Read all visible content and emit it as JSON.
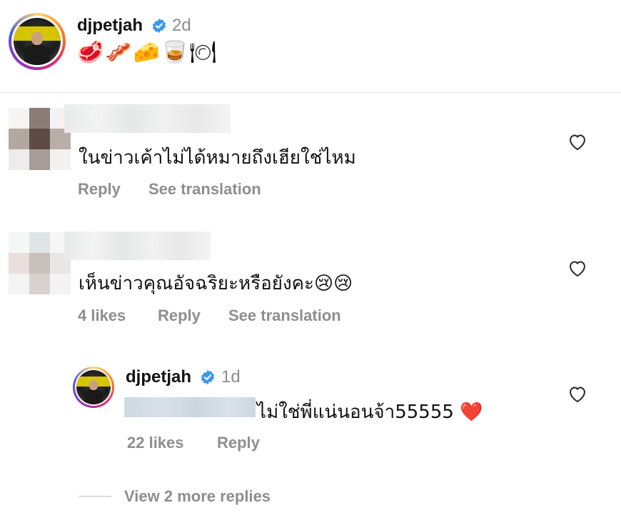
{
  "post": {
    "username": "djpetjah",
    "timestamp": "2d",
    "caption_emoji": "🥩🥓🧀🥃🍽"
  },
  "comments": [
    {
      "text": "ในข่าวเค้าไม่ได้หมายถึงเฮียใช่ไหม",
      "likes": "",
      "reply_label": "Reply",
      "translate_label": "See translation"
    },
    {
      "text": "เห็นข่าวคุณอัจฉริยะหรือยังคะ😢😢",
      "likes": "4 likes",
      "reply_label": "Reply",
      "translate_label": "See translation"
    }
  ],
  "reply": {
    "username": "djpetjah",
    "timestamp": "1d",
    "text": "ไม่ใช่พี่แน่นอนจ้า55555 ❤️",
    "likes": "22 likes",
    "reply_label": "Reply"
  },
  "view_more_label": "View 2 more replies",
  "colors": {
    "verified_blue": "#3897f0",
    "meta_gray": "#8e8e8e",
    "heart_stroke": "#262626"
  }
}
